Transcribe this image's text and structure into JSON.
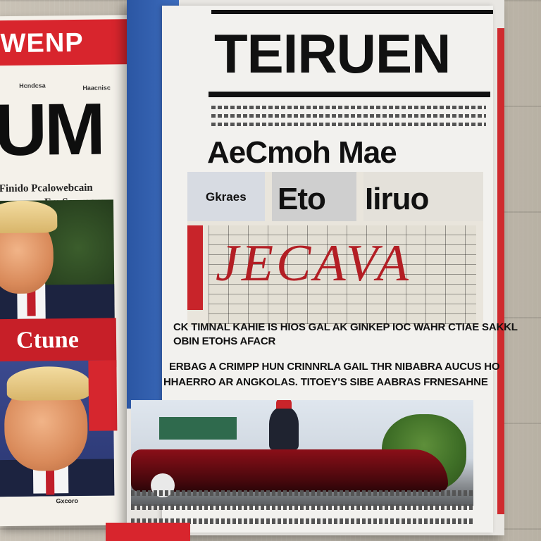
{
  "left_magazine": {
    "brand": "WENP",
    "header_small_left": "Hcndcsa",
    "header_small_right": "Haacnisc",
    "big_title": "UM",
    "sub_line1": "Finido Pcalowebcain",
    "sub_line2": "Fm Sauyocus",
    "red_block_text": "Ctune",
    "caption": "Gxcoro"
  },
  "newspaper": {
    "masthead": "TEIRUEN",
    "headline": "AeCmoh Mae",
    "collage_labels": {
      "left": "Gkraes",
      "center": "Eto",
      "right": "Iiruo",
      "scrawl": "JECAVA"
    },
    "body_lines": [
      "CK TIMNAL KAHIE IS HIOS GAL AK GINKEP IOC WAHR CTIAE SAKKL",
      "OBIN ETOHS AFACR",
      "ERBAG A CRIMPP HUN CRINNRLA GAIL THR NIBABRA AUCUS HO",
      "HHAERRO AR ANGKOLAS. TITOEY'S SIBE AABRAS FRNESAHNE"
    ]
  },
  "colors": {
    "wood": "#c4bdb1",
    "brand_red": "#d8252d",
    "newspaper_blue": "#2b56a3",
    "paper": "#f2f1ee",
    "ink": "#111111"
  }
}
